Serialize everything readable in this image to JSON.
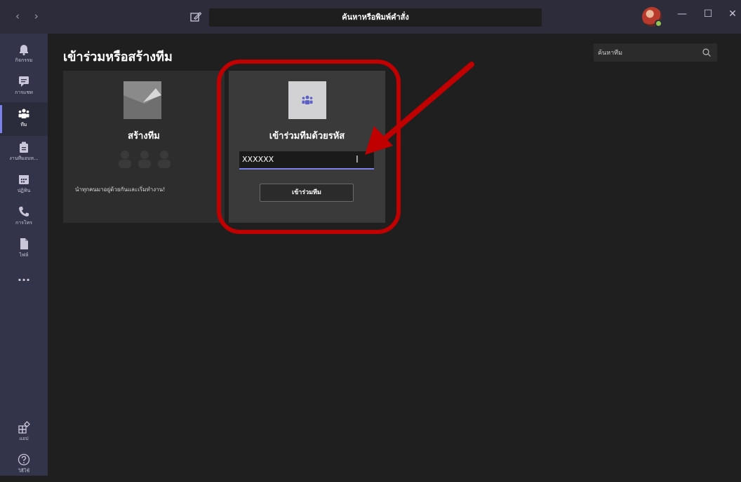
{
  "titlebar": {
    "back": "‹",
    "forward": "›",
    "search_placeholder": "ค้นหาหรือพิมพ์คำสั่ง",
    "minimize": "—",
    "maximize": "☐",
    "close": "✕"
  },
  "rail": {
    "items": [
      {
        "label": "กิจกรรม",
        "icon": "bell-icon"
      },
      {
        "label": "การแชท",
        "icon": "chat-icon"
      },
      {
        "label": "ทีม",
        "icon": "teams-icon"
      },
      {
        "label": "งานที่มอบห...",
        "icon": "assignment-icon"
      },
      {
        "label": "ปฏิทิน",
        "icon": "calendar-icon"
      },
      {
        "label": "การโทร",
        "icon": "phone-icon"
      },
      {
        "label": "ไฟล์",
        "icon": "file-icon"
      },
      {
        "label": "...",
        "icon": "more-icon"
      }
    ],
    "bottom": [
      {
        "label": "แอป",
        "icon": "apps-icon"
      },
      {
        "label": "วิธีใช้",
        "icon": "help-icon"
      }
    ]
  },
  "main": {
    "title": "เข้าร่วมหรือสร้างทีม",
    "team_search_placeholder": "ค้นหาทีม",
    "create_card": {
      "title": "สร้างทีม",
      "description": "นำทุกคนมาอยู่ด้วยกันและเริ่มทำงาน!"
    },
    "join_card": {
      "title": "เข้าร่วมทีมด้วยรหัส",
      "code_value": "XXXXXX",
      "button_label": "เข้าร่วมทีม"
    }
  },
  "colors": {
    "accent": "#7b83eb",
    "annotation": "#c00000"
  }
}
